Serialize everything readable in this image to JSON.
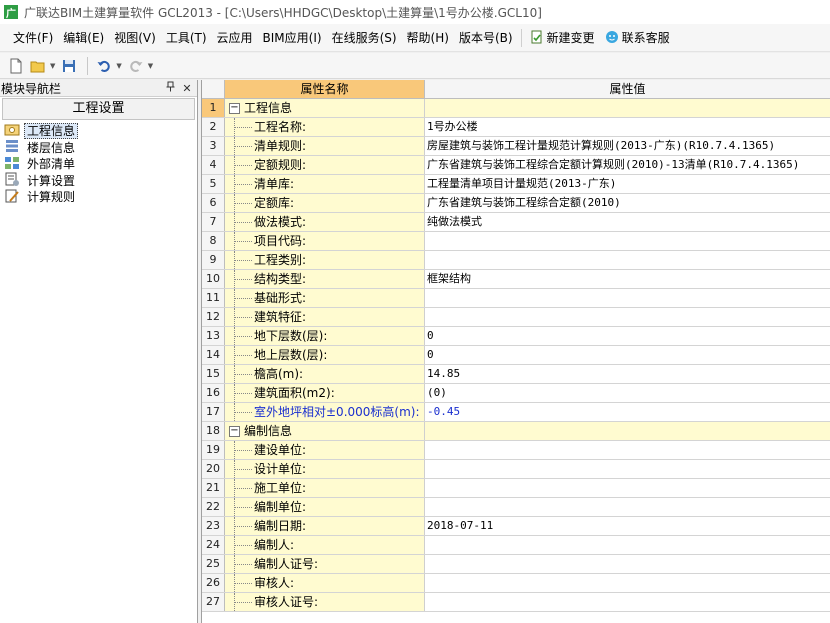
{
  "window": {
    "app_icon_letter": "广",
    "title": "广联达BIM土建算量软件 GCL2013 - [C:\\Users\\HHDGC\\Desktop\\土建算量\\1号办公楼.GCL10]"
  },
  "menu": {
    "items": [
      "文件(F)",
      "编辑(E)",
      "视图(V)",
      "工具(T)",
      "云应用",
      "BIM应用(I)",
      "在线服务(S)",
      "帮助(H)",
      "版本号(B)"
    ],
    "new_change": "新建变更",
    "customer_service": "联系客服"
  },
  "toolbar": {
    "icons": [
      "new-file-icon",
      "open-folder-icon",
      "save-icon",
      "undo-icon",
      "redo-icon"
    ]
  },
  "nav": {
    "title": "模块导航栏",
    "pin": "ᵖ",
    "close": "✕",
    "section": "工程设置",
    "items": [
      {
        "label": "工程信息",
        "icon": "project-info-icon",
        "selected": true
      },
      {
        "label": "楼层信息",
        "icon": "floor-info-icon",
        "selected": false
      },
      {
        "label": "外部清单",
        "icon": "external-list-icon",
        "selected": false
      },
      {
        "label": "计算设置",
        "icon": "calc-settings-icon",
        "selected": false
      },
      {
        "label": "计算规则",
        "icon": "calc-rules-icon",
        "selected": false
      }
    ]
  },
  "grid": {
    "col_name": "属性名称",
    "col_value": "属性值",
    "rows": [
      {
        "no": "1",
        "name": "工程信息",
        "value": "",
        "type": "group"
      },
      {
        "no": "2",
        "name": "工程名称:",
        "value": "1号办公楼",
        "type": "child"
      },
      {
        "no": "3",
        "name": "清单规则:",
        "value": "房屋建筑与装饰工程计量规范计算规则(2013-广东)(R10.7.4.1365)",
        "type": "child"
      },
      {
        "no": "4",
        "name": "定额规则:",
        "value": "广东省建筑与装饰工程综合定额计算规则(2010)-13清单(R10.7.4.1365)",
        "type": "child"
      },
      {
        "no": "5",
        "name": "清单库:",
        "value": "工程量清单项目计量规范(2013-广东)",
        "type": "child"
      },
      {
        "no": "6",
        "name": "定额库:",
        "value": "广东省建筑与装饰工程综合定额(2010)",
        "type": "child"
      },
      {
        "no": "7",
        "name": "做法模式:",
        "value": "纯做法模式",
        "type": "child"
      },
      {
        "no": "8",
        "name": "项目代码:",
        "value": "",
        "type": "child"
      },
      {
        "no": "9",
        "name": "工程类别:",
        "value": "",
        "type": "child"
      },
      {
        "no": "10",
        "name": "结构类型:",
        "value": "框架结构",
        "type": "child"
      },
      {
        "no": "11",
        "name": "基础形式:",
        "value": "",
        "type": "child"
      },
      {
        "no": "12",
        "name": "建筑特征:",
        "value": "",
        "type": "child"
      },
      {
        "no": "13",
        "name": "地下层数(层):",
        "value": "0",
        "type": "child"
      },
      {
        "no": "14",
        "name": "地上层数(层):",
        "value": "0",
        "type": "child"
      },
      {
        "no": "15",
        "name": "檐高(m):",
        "value": "14.85",
        "type": "child"
      },
      {
        "no": "16",
        "name": "建筑面积(m2):",
        "value": "(0)",
        "type": "child"
      },
      {
        "no": "17",
        "name": "室外地坪相对±0.000标高(m):",
        "value": "-0.45",
        "type": "child",
        "highlight": true
      },
      {
        "no": "18",
        "name": "编制信息",
        "value": "",
        "type": "group"
      },
      {
        "no": "19",
        "name": "建设单位:",
        "value": "",
        "type": "child"
      },
      {
        "no": "20",
        "name": "设计单位:",
        "value": "",
        "type": "child"
      },
      {
        "no": "21",
        "name": "施工单位:",
        "value": "",
        "type": "child"
      },
      {
        "no": "22",
        "name": "编制单位:",
        "value": "",
        "type": "child"
      },
      {
        "no": "23",
        "name": "编制日期:",
        "value": "2018-07-11",
        "type": "child"
      },
      {
        "no": "24",
        "name": "编制人:",
        "value": "",
        "type": "child"
      },
      {
        "no": "25",
        "name": "编制人证号:",
        "value": "",
        "type": "child"
      },
      {
        "no": "26",
        "name": "审核人:",
        "value": "",
        "type": "child"
      },
      {
        "no": "27",
        "name": "审核人证号:",
        "value": "",
        "type": "child"
      }
    ]
  },
  "colors": {
    "header_accent": "#f9c87a",
    "name_cell_bg": "#fffbd0",
    "highlight_text": "#1a2fcf",
    "app_icon_bg": "#2e9d44"
  }
}
